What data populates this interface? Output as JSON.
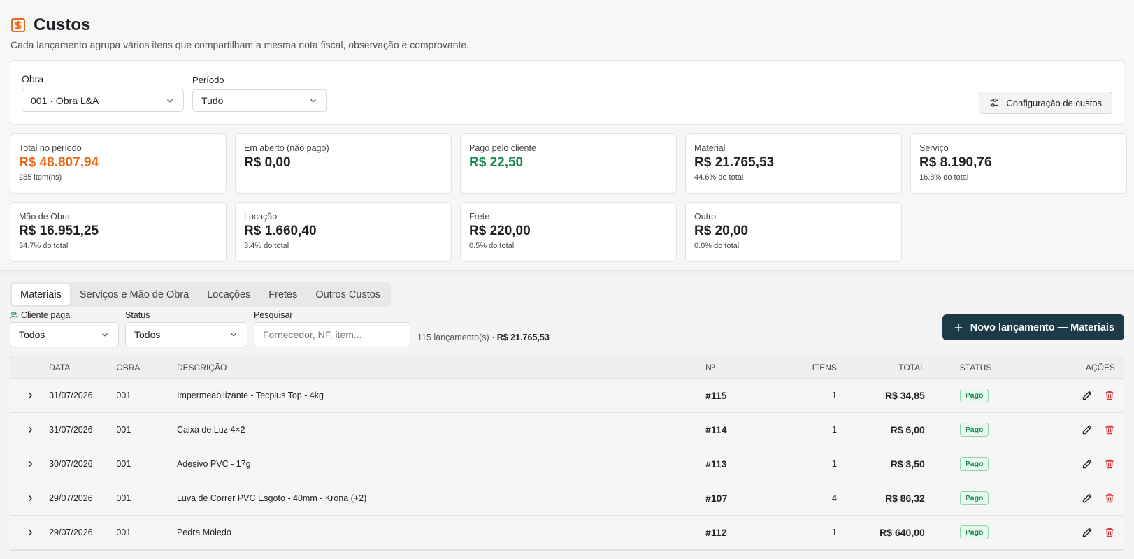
{
  "header": {
    "title": "Custos",
    "subtitle": "Cada lançamento agrupa vários itens que compartilham a mesma nota fiscal, observação e comprovante."
  },
  "filters": {
    "obra_label": "Obra",
    "obra_value": "001 · Obra L&A",
    "periodo_label": "Período",
    "periodo_value": "Tudo",
    "config_button": "Configuração de custos"
  },
  "stats": [
    {
      "label": "Total no período",
      "value": "R$ 48.807,94",
      "sub": "285 item(ns)",
      "color": "orange"
    },
    {
      "label": "Em aberto (não pago)",
      "value": "R$ 0,00",
      "sub": "",
      "color": "default"
    },
    {
      "label": "Pago pelo cliente",
      "value": "R$ 22,50",
      "sub": "",
      "color": "green"
    },
    {
      "label": "Material",
      "value": "R$ 21.765,53",
      "sub": "44.6% do total",
      "color": "default"
    },
    {
      "label": "Serviço",
      "value": "R$ 8.190,76",
      "sub": "16.8% do total",
      "color": "default"
    },
    {
      "label": "Mão de Obra",
      "value": "R$ 16.951,25",
      "sub": "34.7% do total",
      "color": "default"
    },
    {
      "label": "Locação",
      "value": "R$ 1.660,40",
      "sub": "3.4% do total",
      "color": "default"
    },
    {
      "label": "Frete",
      "value": "R$ 220,00",
      "sub": "0.5% do total",
      "color": "default"
    },
    {
      "label": "Outro",
      "value": "R$ 20,00",
      "sub": "0.0% do total",
      "color": "default"
    }
  ],
  "tabs": [
    {
      "label": "Materiais",
      "active": true
    },
    {
      "label": "Serviços e Mão de Obra",
      "active": false
    },
    {
      "label": "Locações",
      "active": false
    },
    {
      "label": "Fretes",
      "active": false
    },
    {
      "label": "Outros Custos",
      "active": false
    }
  ],
  "list_filters": {
    "cliente_label": "Cliente paga",
    "cliente_value": "Todos",
    "status_label": "Status",
    "status_value": "Todos",
    "search_label": "Pesquisar",
    "search_placeholder": "Fornecedor, NF, item...",
    "summary_count": "115 lançamento(s) · ",
    "summary_total": "R$ 21.765,53",
    "new_button": "Novo lançamento — Materiais"
  },
  "table": {
    "headers": {
      "data": "DATA",
      "obra": "OBRA",
      "descricao": "DESCRIÇÃO",
      "num": "Nº",
      "itens": "ITENS",
      "total": "TOTAL",
      "status": "STATUS",
      "acoes": "AÇÕES"
    },
    "rows": [
      {
        "data": "31/07/2026",
        "obra": "001",
        "descricao": "Impermeabilizante - Tecplus Top - 4kg",
        "num": "#115",
        "itens": "1",
        "total": "R$ 34,85",
        "status": "Pago"
      },
      {
        "data": "31/07/2026",
        "obra": "001",
        "descricao": "Caixa de Luz 4×2",
        "num": "#114",
        "itens": "1",
        "total": "R$ 6,00",
        "status": "Pago"
      },
      {
        "data": "30/07/2026",
        "obra": "001",
        "descricao": "Adesivo PVC - 17g",
        "num": "#113",
        "itens": "1",
        "total": "R$ 3,50",
        "status": "Pago"
      },
      {
        "data": "29/07/2026",
        "obra": "001",
        "descricao": "Luva de Correr PVC Esgoto - 40mm - Krona (+2)",
        "num": "#107",
        "itens": "4",
        "total": "R$ 86,32",
        "status": "Pago"
      },
      {
        "data": "29/07/2026",
        "obra": "001",
        "descricao": "Pedra Moledo",
        "num": "#112",
        "itens": "1",
        "total": "R$ 640,00",
        "status": "Pago"
      }
    ]
  },
  "colors": {
    "accent_orange": "#ea6a1a",
    "accent_green": "#1b8a55",
    "primary_dark": "#1c3a48",
    "danger_red": "#d9363e"
  }
}
